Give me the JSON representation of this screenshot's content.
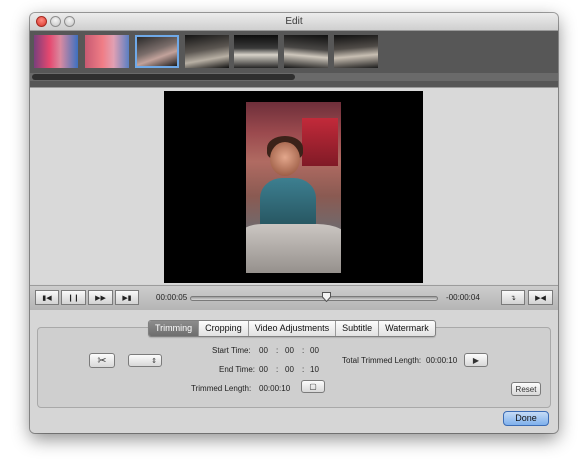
{
  "window": {
    "title": "Edit"
  },
  "thumbnails": [
    "frame-1",
    "frame-2",
    "frame-3",
    "frame-4",
    "frame-5",
    "frame-6",
    "frame-7"
  ],
  "player": {
    "current_time": "00:00:05",
    "remaining_time": "-00:00:04",
    "progress": 0.55,
    "buttons": {
      "prev_icon": "skip-start-icon",
      "pause_icon": "pause-icon",
      "fast_forward_icon": "fast-forward-icon",
      "next_icon": "skip-end-icon",
      "mark_in_icon": "mark-in-icon",
      "mark_out_icon": "mark-out-icon"
    }
  },
  "tabs": [
    "Trimming",
    "Cropping",
    "Video Adjustments",
    "Subtitle",
    "Watermark"
  ],
  "active_tab": "Trimming",
  "trimming": {
    "start_time_label": "Start Time:",
    "start_h": "00",
    "start_m": "00",
    "start_s": "00",
    "end_time_label": "End Time:",
    "end_h": "00",
    "end_m": "00",
    "end_s": "10",
    "separator": ":",
    "trimmed_length_label": "Trimmed Length:",
    "trimmed_length_value": "00:00:10",
    "total_trimmed_length_label": "Total Trimmed Length:",
    "total_trimmed_length_value": "00:00:10",
    "reset_label": "Reset"
  },
  "footer": {
    "done_label": "Done"
  },
  "colors": {
    "accent": "#7fb0ec",
    "close": "#d8342a"
  }
}
